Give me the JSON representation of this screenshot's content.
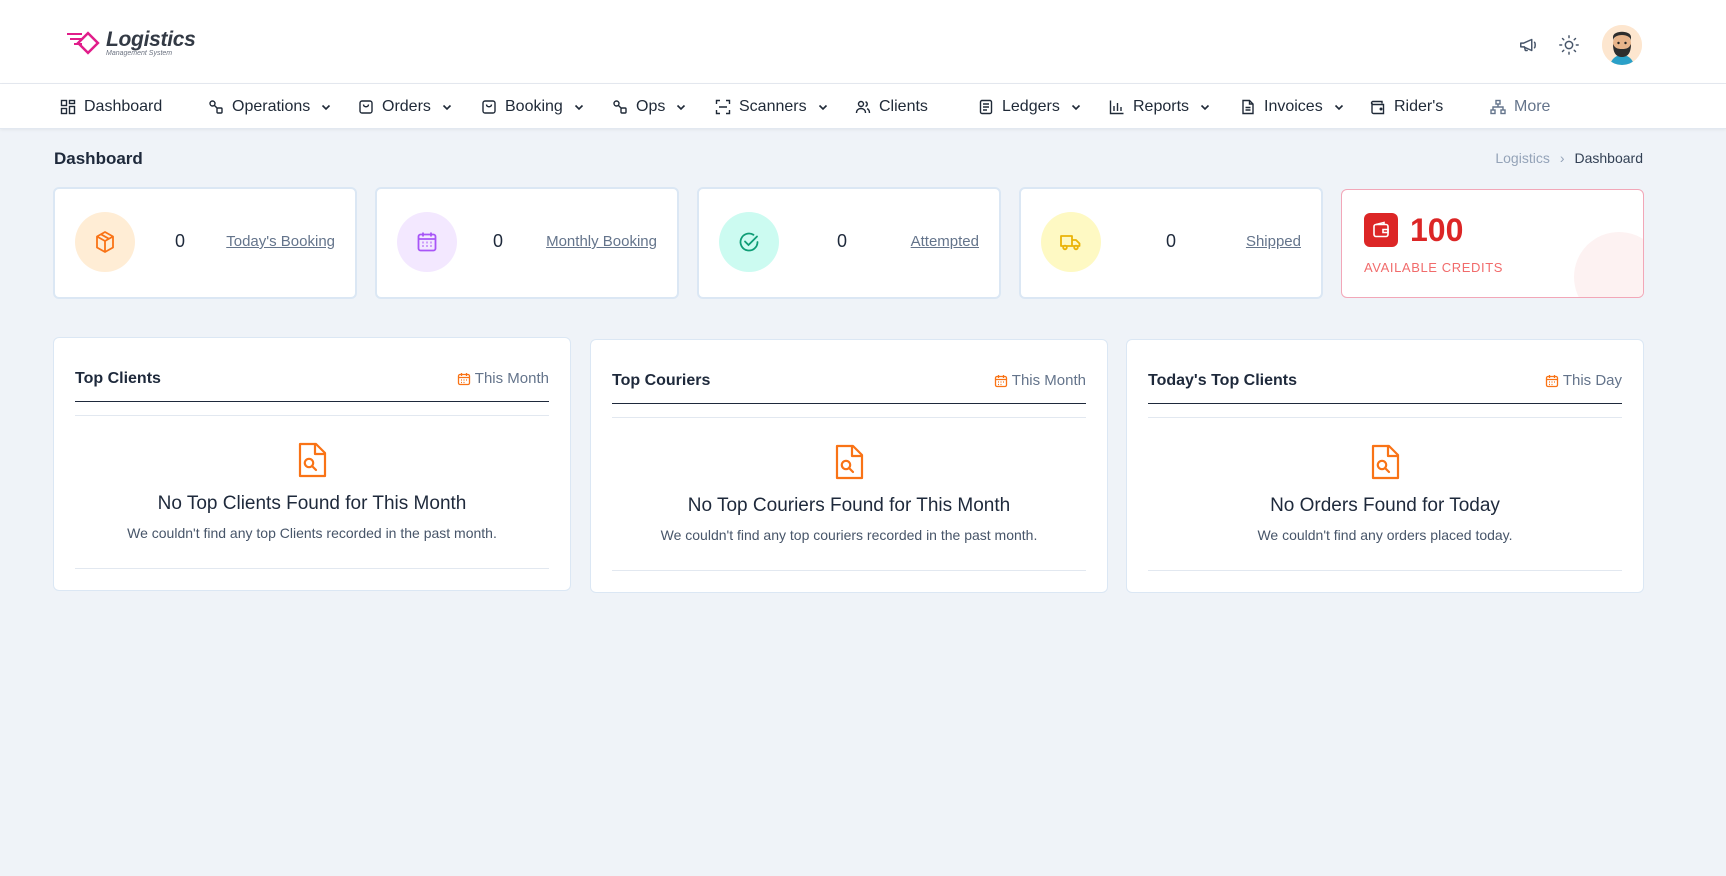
{
  "brand": {
    "title": "Logistics",
    "subtitle": "Management System",
    "accent": "#e11d8a"
  },
  "header": {
    "icons": [
      "megaphone-icon",
      "sun-icon"
    ],
    "avatar": "user-avatar"
  },
  "nav": [
    {
      "label": "Dashboard",
      "icon": "grid-icon",
      "dropdown": false
    },
    {
      "label": "Operations",
      "icon": "operations-icon",
      "dropdown": true
    },
    {
      "label": "Orders",
      "icon": "bag-icon",
      "dropdown": true
    },
    {
      "label": "Booking",
      "icon": "bag-icon",
      "dropdown": true
    },
    {
      "label": "Ops",
      "icon": "operations-icon",
      "dropdown": true
    },
    {
      "label": "Scanners",
      "icon": "scan-icon",
      "dropdown": true
    },
    {
      "label": "Clients",
      "icon": "users-icon",
      "dropdown": false
    },
    {
      "label": "Ledgers",
      "icon": "ledger-icon",
      "dropdown": true
    },
    {
      "label": "Reports",
      "icon": "bar-chart-icon",
      "dropdown": true
    },
    {
      "label": "Invoices",
      "icon": "document-icon",
      "dropdown": true
    },
    {
      "label": "Rider's",
      "icon": "wallet-icon",
      "dropdown": false
    },
    {
      "label": "More",
      "icon": "sitemap-icon",
      "dropdown": false
    }
  ],
  "page": {
    "title": "Dashboard",
    "breadcrumb": [
      "Logistics",
      "Dashboard"
    ],
    "breadcrumb_sep": "›"
  },
  "stats": [
    {
      "value": "0",
      "label": "Today's Booking",
      "icon": "box-icon",
      "color": "#f97316",
      "bg": "#ffedd5"
    },
    {
      "value": "0",
      "label": "Monthly Booking",
      "icon": "calendar-icon",
      "color": "#a855f7",
      "bg": "#f3e8ff"
    },
    {
      "value": "0",
      "label": "Attempted",
      "icon": "check-circle-icon",
      "color": "#0f9d76",
      "bg": "#ccfbf1"
    },
    {
      "value": "0",
      "label": "Shipped",
      "icon": "truck-icon",
      "color": "#eab308",
      "bg": "#fef9c3"
    }
  ],
  "credits": {
    "amount": "100",
    "label": "AVAILABLE CREDITS",
    "color": "#dc2626"
  },
  "panels": [
    {
      "title": "Top Clients",
      "range": "This Month",
      "empty_title": "No Top Clients Found for This Month",
      "empty_desc": "We couldn't find any top Clients recorded in the past month."
    },
    {
      "title": "Top Couriers",
      "range": "This Month",
      "empty_title": "No Top Couriers Found for This Month",
      "empty_desc": "We couldn't find any top couriers recorded in the past month."
    },
    {
      "title": "Today's Top Clients",
      "range": "This Day",
      "empty_title": "No Orders Found for Today",
      "empty_desc": "We couldn't find any orders placed today."
    }
  ]
}
